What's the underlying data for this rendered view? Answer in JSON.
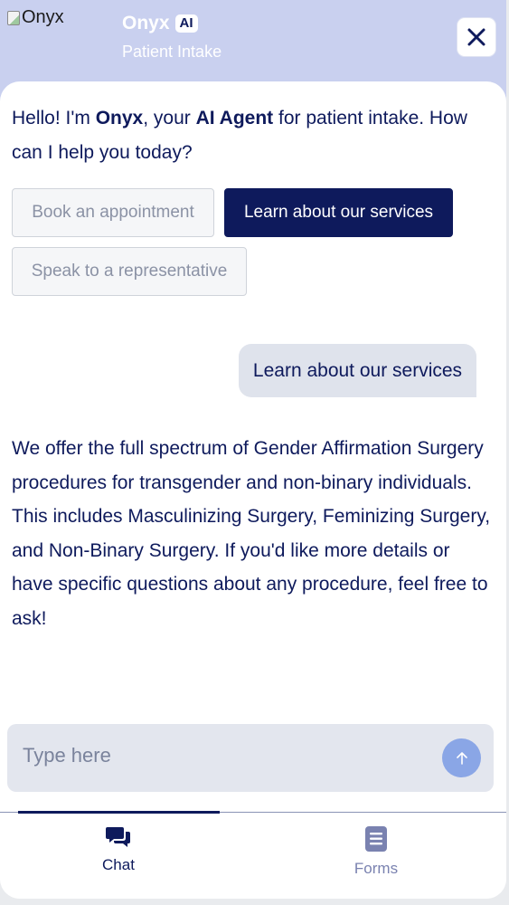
{
  "header": {
    "logo_alt": "Onyx",
    "brand_name": "Onyx",
    "brand_badge": "AI",
    "subtitle": "Patient Intake"
  },
  "chat": {
    "greeting": {
      "part1": "Hello! I'm ",
      "bold1": "Onyx",
      "part2": ", your ",
      "bold2": "AI Agent",
      "part3": " for patient intake. How can I help you today?"
    },
    "quick_replies": [
      {
        "label": "Book an appointment"
      },
      {
        "label": "Learn about our services"
      },
      {
        "label": "Speak to a representative"
      }
    ],
    "user_message": "Learn about our services",
    "bot_reply": "We offer the full spectrum of Gender Affirmation Surgery procedures for transgender and non-binary individuals. This includes Masculinizing Surgery, Feminizing Surgery, and Non-Binary Surgery. If you'd like more details or have specific questions about any procedure, feel free to ask!"
  },
  "composer": {
    "placeholder": "Type here",
    "value": ""
  },
  "tabs": [
    {
      "label": "Chat",
      "icon": "chat-bubbles-icon",
      "active": true
    },
    {
      "label": "Forms",
      "icon": "document-icon",
      "active": false
    }
  ],
  "colors": {
    "header_bg": "#c9d0ef",
    "navy": "#0e1a5c",
    "send_button": "#8aa6e6",
    "composer_bg": "#e3e6ee",
    "user_bubble": "#dfe3ec"
  }
}
